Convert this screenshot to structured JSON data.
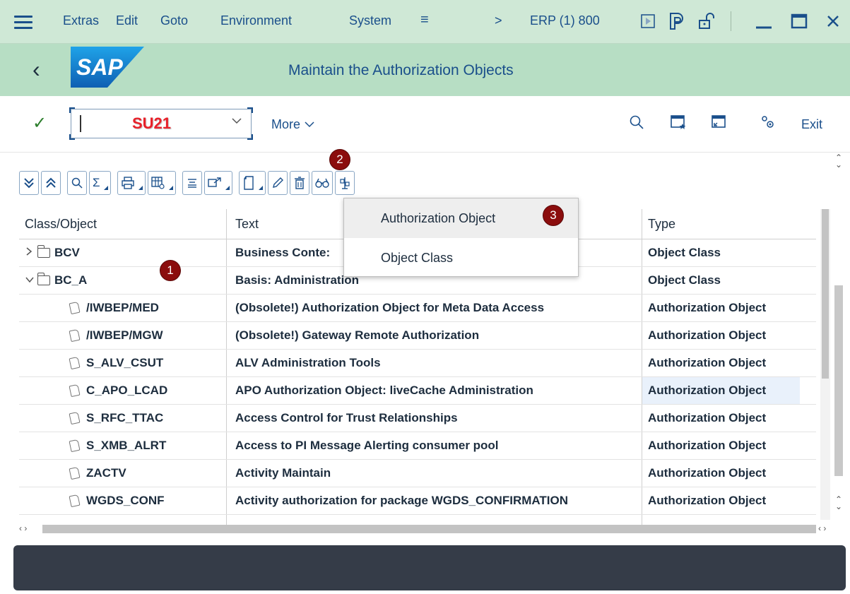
{
  "menubar": {
    "items": [
      "Extras",
      "Edit",
      "Goto",
      "Environment",
      "System"
    ],
    "more_symbol": "≡",
    "arrow": ">",
    "system_info": "ERP (1) 800",
    "icons": [
      "hamburger-icon",
      "play-icon",
      "customize-icon",
      "lock-icon",
      "minimize-icon",
      "maximize-icon",
      "close-icon"
    ]
  },
  "titlebar": {
    "back": "‹",
    "logo": "SAP",
    "title": "Maintain the Authorization Objects",
    "bg_color": "#b7dec4"
  },
  "toolbar": {
    "check": "✓",
    "command_value": "SU21",
    "more_label": "More",
    "exit_label": "Exit",
    "icons": [
      "search-icon",
      "favorite-icon",
      "new-session-icon",
      "settings-icon"
    ]
  },
  "alv_toolbar": {
    "buttons": [
      "expand-all-icon",
      "collapse-all-icon",
      "search-icon",
      "sum-icon",
      "print-icon",
      "layout-icon",
      "details-icon",
      "export-icon",
      "create-icon",
      "edit-icon",
      "delete-icon",
      "display-icon",
      "compare-icon"
    ]
  },
  "badges": [
    "1",
    "2",
    "3"
  ],
  "table": {
    "headers": [
      "Class/Object",
      "Text",
      "Type"
    ],
    "rows": [
      {
        "name": "BCV",
        "text": "Business Conte:",
        "type": "Object Class",
        "kind": "class",
        "expanded": false
      },
      {
        "name": "BC_A",
        "text": "Basis: Administration",
        "type": "Object Class",
        "kind": "class",
        "expanded": true
      },
      {
        "name": "/IWBEP/MED",
        "text": "(Obsolete!) Authorization Object for Meta Data Access",
        "type": "Authorization Object",
        "kind": "object"
      },
      {
        "name": "/IWBEP/MGW",
        "text": "(Obsolete!) Gateway Remote Authorization",
        "type": "Authorization Object",
        "kind": "object"
      },
      {
        "name": "S_ALV_CSUT",
        "text": "ALV Administration Tools",
        "type": "Authorization Object",
        "kind": "object"
      },
      {
        "name": "C_APO_LCAD",
        "text": "APO Authorization Object: liveCache Administration",
        "type": "Authorization Object",
        "kind": "object",
        "highlight": true
      },
      {
        "name": "S_RFC_TTAC",
        "text": "Access Control for Trust Relationships",
        "type": "Authorization Object",
        "kind": "object"
      },
      {
        "name": "S_XMB_ALRT",
        "text": "Access to PI Message Alerting consumer pool",
        "type": "Authorization Object",
        "kind": "object"
      },
      {
        "name": "ZACTV",
        "text": "Activity Maintain",
        "type": "Authorization Object",
        "kind": "object"
      },
      {
        "name": "WGDS_CONF",
        "text": "Activity authorization for package WGDS_CONFIRMATION",
        "type": "Authorization Object",
        "kind": "object"
      }
    ]
  },
  "popup": {
    "options": [
      {
        "label": "Authorization Object",
        "selected": true
      },
      {
        "label": "Object Class",
        "selected": false
      }
    ]
  },
  "colors": {
    "menubar_bg": "#cfe8d6",
    "link_blue": "#1a4f8b",
    "badge": "#8b0d0d",
    "statusbar": "#353c48",
    "command_text": "#e8212a"
  }
}
